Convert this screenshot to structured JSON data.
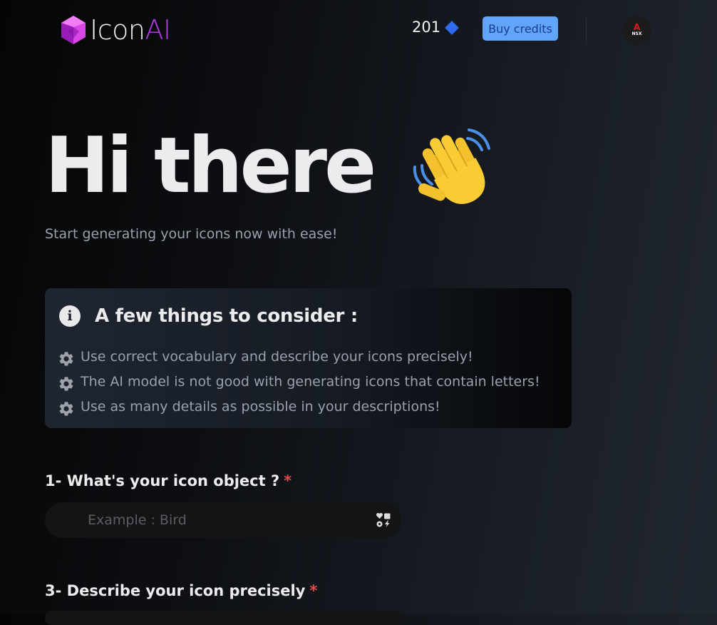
{
  "header": {
    "logo_text_primary": "Icon",
    "logo_text_accent": "AI",
    "credits_value": "201",
    "credits_icon": "diamond-icon",
    "buy_label": "Buy credits",
    "avatar_text_top": "A",
    "avatar_text_bottom": "NSX"
  },
  "hero": {
    "title": "Hi there",
    "emoji_icon": "waving-hand-icon",
    "subtitle": "Start generating your icons now with ease!"
  },
  "tips_card": {
    "title": "A few things to consider :",
    "items": [
      "Use correct vocabulary and describe your icons precisely!",
      "The AI model is not good with generating icons that contain letters!",
      "Use as many details as possible in your descriptions!"
    ]
  },
  "form": {
    "q1_label": "1- What's your icon object ?",
    "q1_placeholder": "Example : Bird",
    "q3_label": "3- Describe your icon precisely",
    "required_mark": "*"
  },
  "colors": {
    "accent_purple": "#b23be8",
    "credit_diamond": "#2f6bf0",
    "buy_button_bg": "#60a5fa",
    "required_red": "#e5484d"
  }
}
